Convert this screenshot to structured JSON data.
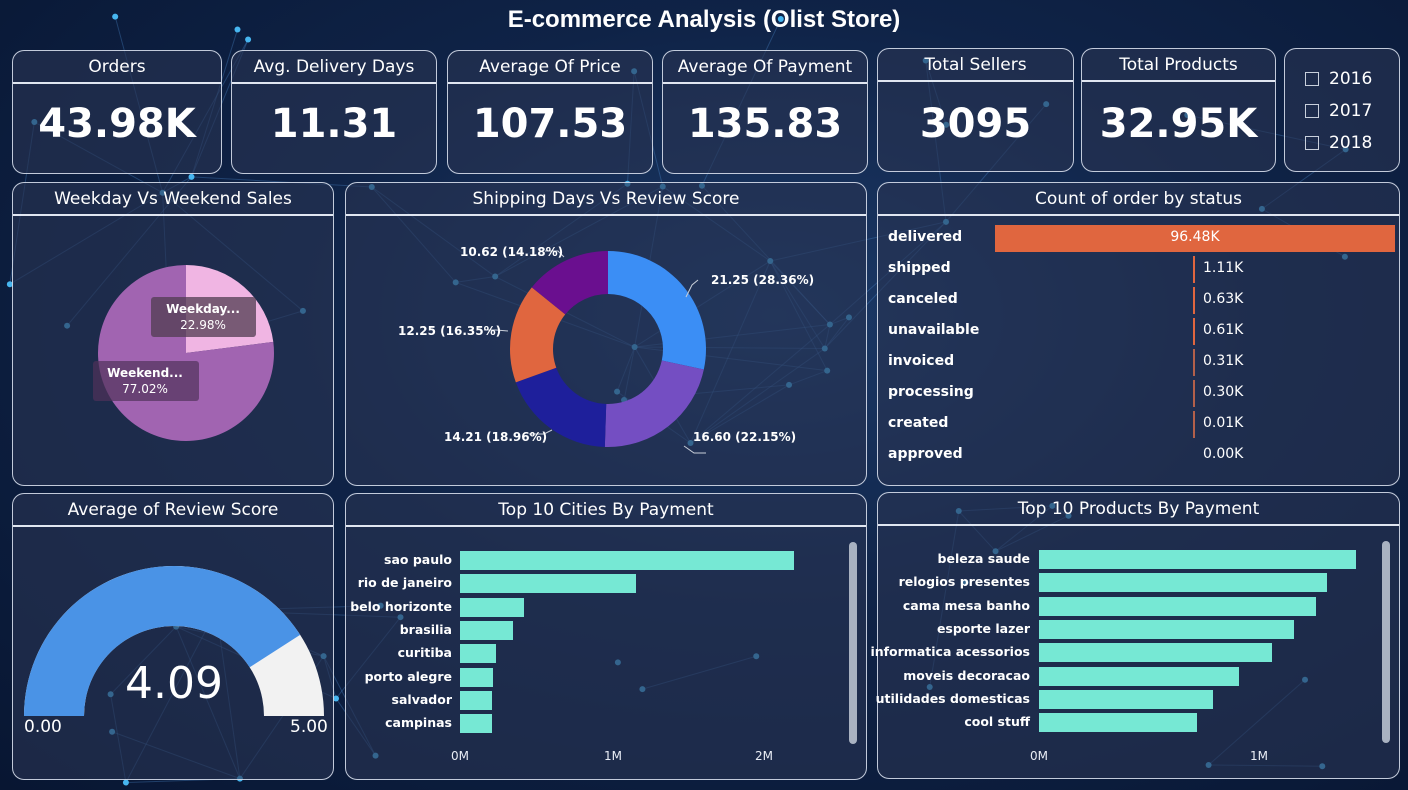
{
  "title": "E-commerce Analysis (Olist Store)",
  "kpis": {
    "orders": {
      "label": "Orders",
      "value": "43.98K"
    },
    "delivery": {
      "label": "Avg. Delivery Days",
      "value": "11.31"
    },
    "price": {
      "label": "Average Of Price",
      "value": "107.53"
    },
    "payment": {
      "label": "Average Of Payment",
      "value": "135.83"
    },
    "sellers": {
      "label": "Total Sellers",
      "value": "3095"
    },
    "products": {
      "label": "Total Products",
      "value": "32.95K"
    }
  },
  "years": [
    "2016",
    "2017",
    "2018"
  ],
  "weekday": {
    "title": "Weekday Vs Weekend Sales",
    "labels": {
      "weekday_name": "Weekday...",
      "weekday_pct": "22.98%",
      "weekend_name": "Weekend...",
      "weekend_pct": "77.02%"
    }
  },
  "shipping": {
    "title": "Shipping Days Vs Review Score",
    "labels": [
      "21.25 (28.36%)",
      "16.60 (22.15%)",
      "14.21 (18.96%)",
      "12.25 (16.35%)",
      "10.62 (14.18%)"
    ]
  },
  "status": {
    "title": "Count of order by status",
    "rows": [
      {
        "label": "delivered",
        "value": "96.48K",
        "num": 96.48
      },
      {
        "label": "shipped",
        "value": "1.11K",
        "num": 1.11
      },
      {
        "label": "canceled",
        "value": "0.63K",
        "num": 0.63
      },
      {
        "label": "unavailable",
        "value": "0.61K",
        "num": 0.61
      },
      {
        "label": "invoiced",
        "value": "0.31K",
        "num": 0.31
      },
      {
        "label": "processing",
        "value": "0.30K",
        "num": 0.3
      },
      {
        "label": "created",
        "value": "0.01K",
        "num": 0.01
      },
      {
        "label": "approved",
        "value": "0.00K",
        "num": 0.0
      }
    ]
  },
  "review": {
    "title": "Average of Review Score",
    "value": "4.09",
    "min": "0.00",
    "max": "5.00",
    "num": 4.09,
    "max_num": 5
  },
  "cities": {
    "title": "Top 10 Cities By Payment",
    "labels": [
      "sao paulo",
      "rio de janeiro",
      "belo horizonte",
      "brasilia",
      "curitiba",
      "porto alegre",
      "salvador",
      "campinas"
    ],
    "ticks": [
      "0M",
      "1M",
      "2M"
    ]
  },
  "products": {
    "title": "Top 10 Products By Payment",
    "labels": [
      "beleza saude",
      "relogios presentes",
      "cama mesa banho",
      "esporte lazer",
      "informatica acessorios",
      "moveis decoracao",
      "utilidades domesticas",
      "cool stuff"
    ],
    "ticks": [
      "0M",
      "1M"
    ]
  },
  "chart_data": [
    {
      "type": "pie",
      "title": "Weekday Vs Weekend Sales",
      "categories": [
        "Weekday",
        "Weekend"
      ],
      "values": [
        22.98,
        77.02
      ],
      "colors": [
        "#f0b5e3",
        "#a164b1"
      ]
    },
    {
      "type": "pie",
      "title": "Shipping Days Vs Review Score",
      "categories": [
        "21.25",
        "16.60",
        "14.21",
        "12.25",
        "10.62"
      ],
      "values": [
        21.25,
        16.6,
        14.21,
        12.25,
        10.62
      ],
      "percents": [
        28.36,
        22.15,
        18.96,
        16.35,
        14.18
      ],
      "colors": [
        "#3b8ef5",
        "#744ec2",
        "#1e1f9b",
        "#e0663f",
        "#6a0f8f"
      ]
    },
    {
      "type": "bar",
      "title": "Count of order by status",
      "categories": [
        "delivered",
        "shipped",
        "canceled",
        "unavailable",
        "invoiced",
        "processing",
        "created",
        "approved"
      ],
      "values": [
        96.48,
        1.11,
        0.63,
        0.61,
        0.31,
        0.3,
        0.01,
        0.0
      ],
      "unit": "K"
    },
    {
      "type": "bar",
      "title": "Top 10 Cities By Payment",
      "categories": [
        "sao paulo",
        "rio de janeiro",
        "belo horizonte",
        "brasilia",
        "curitiba",
        "porto alegre",
        "salvador",
        "campinas"
      ],
      "values": [
        2.2,
        1.16,
        0.42,
        0.35,
        0.24,
        0.22,
        0.21,
        0.21
      ],
      "unit": "M",
      "xlim": [
        0,
        2.3
      ]
    },
    {
      "type": "bar",
      "title": "Top 10 Products By Payment",
      "categories": [
        "beleza saude",
        "relogios presentes",
        "cama mesa banho",
        "esporte lazer",
        "informatica acessorios",
        "moveis decoracao",
        "utilidades domesticas",
        "cool stuff"
      ],
      "values": [
        1.44,
        1.31,
        1.26,
        1.16,
        1.06,
        0.91,
        0.79,
        0.72
      ],
      "unit": "M",
      "xlim": [
        0,
        1.5
      ]
    }
  ],
  "colors": {
    "accent_orange": "#e0663f",
    "teal_bar": "#76e8d4",
    "gauge_fill": "#4a93e6",
    "gauge_track": "#f2f2f2"
  }
}
